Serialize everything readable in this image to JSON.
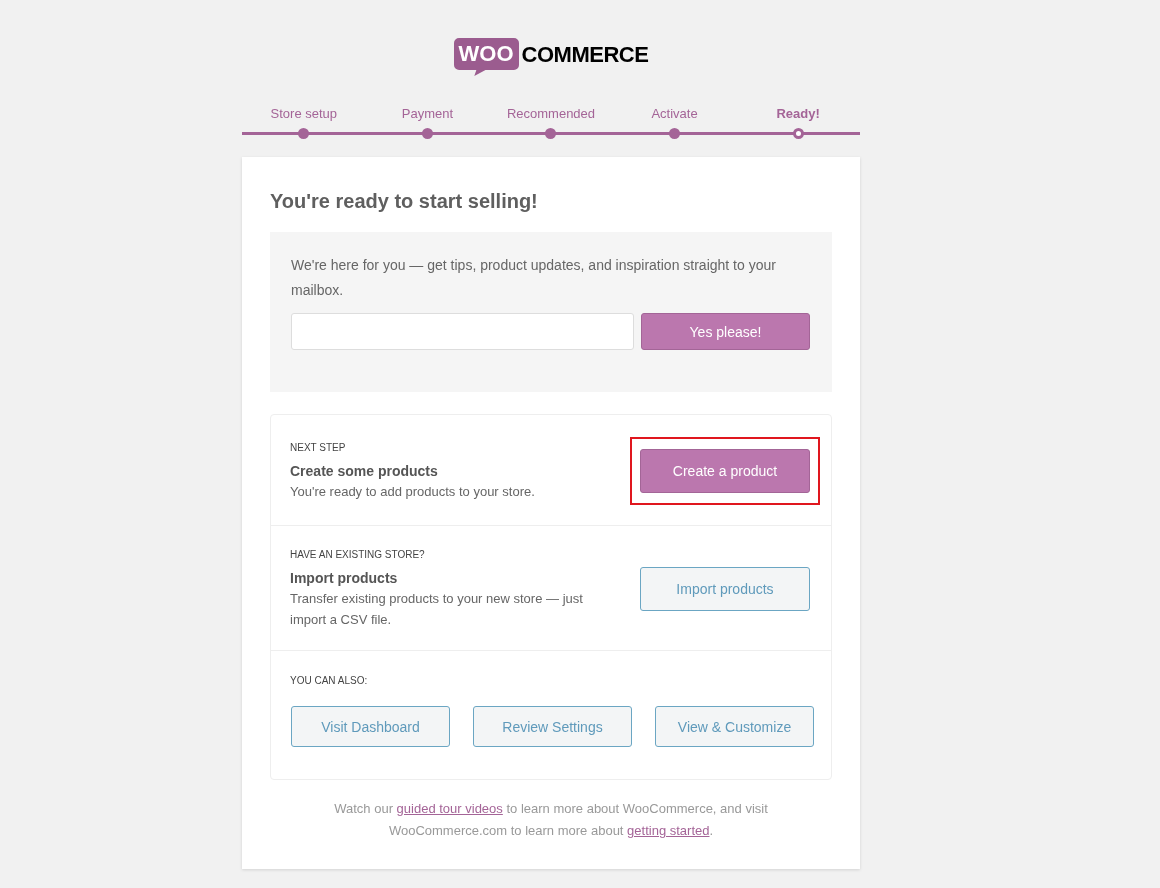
{
  "logo": {
    "badge": "WOO",
    "wordmark": "COMMERCE"
  },
  "steps": [
    {
      "label": "Store setup",
      "current": false
    },
    {
      "label": "Payment",
      "current": false
    },
    {
      "label": "Recommended",
      "current": false
    },
    {
      "label": "Activate",
      "current": false
    },
    {
      "label": "Ready!",
      "current": true
    }
  ],
  "heading": "You're ready to start selling!",
  "newsletter": {
    "text": "We're here for you — get tips, product updates, and inspiration straight to your mailbox.",
    "button": "Yes please!"
  },
  "next_steps": [
    {
      "kind": "task",
      "eyebrow": "NEXT STEP",
      "title": "Create some products",
      "description": "You're ready to add products to your store.",
      "buttons": [
        {
          "label": "Create a product",
          "kind": "primary",
          "highlighted": true
        }
      ]
    },
    {
      "kind": "task",
      "eyebrow": "HAVE AN EXISTING STORE?",
      "title": "Import products",
      "description": "Transfer existing products to your new store — just import a CSV file.",
      "buttons": [
        {
          "label": "Import products",
          "kind": "secondary",
          "highlighted": false
        }
      ]
    },
    {
      "kind": "extras",
      "eyebrow": "YOU CAN ALSO:",
      "buttons": [
        {
          "label": "Visit Dashboard",
          "kind": "secondary",
          "highlighted": false
        },
        {
          "label": "Review Settings",
          "kind": "secondary",
          "highlighted": false
        },
        {
          "label": "View & Customize",
          "kind": "secondary",
          "highlighted": false
        }
      ]
    }
  ],
  "footer": [
    {
      "kind": "text",
      "text": "Watch our "
    },
    {
      "kind": "link",
      "text": "guided tour videos"
    },
    {
      "kind": "text",
      "text": " to learn more about WooCommerce, and visit WooCommerce.com to learn more about "
    },
    {
      "kind": "link",
      "text": "getting started"
    },
    {
      "kind": "text",
      "text": "."
    }
  ]
}
